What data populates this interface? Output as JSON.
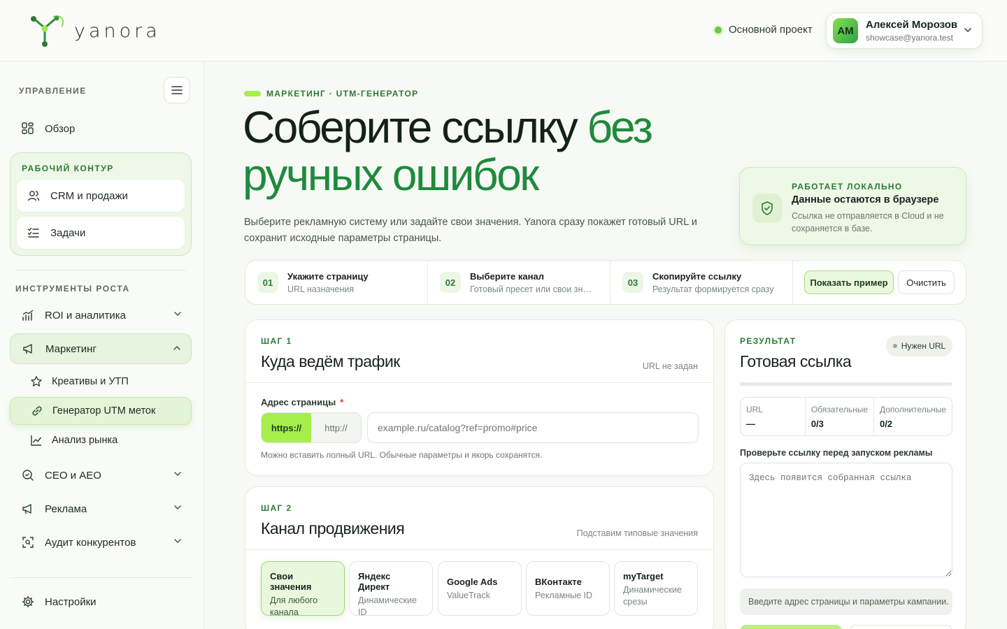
{
  "brand": {
    "name": "yanora"
  },
  "header": {
    "project": "Основной проект",
    "user": {
      "initials": "АМ",
      "name": "Алексей Морозов",
      "email": "showcase@yanora.test"
    }
  },
  "sidebar": {
    "section_manage": "УПРАВЛЕНИЕ",
    "overview": "Обзор",
    "workzone": {
      "title": "РАБОЧИЙ КОНТУР",
      "items": [
        "CRM и продажи",
        "Задачи"
      ]
    },
    "section_growth": "ИНСТРУМЕНТЫ РОСТА",
    "roi": "ROI и аналитика",
    "marketing": "Маркетинг",
    "marketing_sub": [
      "Креативы и УТП",
      "Генератор UTM меток",
      "Анализ рынка"
    ],
    "seo": "СЕО и АЕО",
    "ads": "Реклама",
    "audit": "Аудит конкурентов",
    "settings": "Настройки"
  },
  "main": {
    "eyebrow": "МАРКЕТИНГ · UTM-ГЕНЕРАТОР",
    "hero_dark": "Соберите ссылку ",
    "hero_green": "без ручных ошибок",
    "lead": "Выберите рекламную систему или задайте свои значения. Yanora сразу покажет готовый URL и сохранит исходные параметры страницы.",
    "local": {
      "label": "РАБОТАЕТ ЛОКАЛЬНО",
      "title": "Данные остаются в браузере",
      "desc": "Ссылка не отправляется в Cloud и не сохраняется в базе."
    },
    "steps": [
      {
        "num": "01",
        "title": "Укажите страницу",
        "desc": "URL назначения"
      },
      {
        "num": "02",
        "title": "Выберите канал",
        "desc": "Готовый пресет или свои значения"
      },
      {
        "num": "03",
        "title": "Скопируйте ссылку",
        "desc": "Результат формируется сразу"
      }
    ],
    "btn_example": "Показать пример",
    "btn_clear": "Очистить",
    "step1": {
      "label": "ШАГ 1",
      "title": "Куда ведём трафик",
      "note": "URL не задан",
      "field_label": "Адрес страницы",
      "required_mark": "*",
      "proto_on": "https://",
      "proto_off": "http://",
      "url_placeholder": "example.ru/catalog?ref=promo#price",
      "hint": "Можно вставить полный URL. Обычные параметры и якорь сохранятся."
    },
    "step2": {
      "label": "ШАГ 2",
      "title": "Канал продвижения",
      "note": "Подставим типовые значения",
      "channels": [
        {
          "name": "Свои значения",
          "desc": "Для любого канала"
        },
        {
          "name": "Яндекс Директ",
          "desc": "Динамические ID"
        },
        {
          "name": "Google Ads",
          "desc": "ValueTrack"
        },
        {
          "name": "ВКонтакте",
          "desc": "Рекламные ID"
        },
        {
          "name": "myTarget",
          "desc": "Динамические срезы"
        }
      ]
    },
    "result": {
      "label": "РЕЗУЛЬТАТ",
      "badge": "Нужен URL",
      "title": "Готовая ссылка",
      "progress": 0,
      "stats": [
        {
          "label": "URL",
          "value": "—"
        },
        {
          "label": "Обязательные",
          "value": "0/3"
        },
        {
          "label": "Дополнительные",
          "value": "0/2"
        }
      ],
      "check_label": "Проверьте ссылку перед запуском рекламы",
      "placeholder": "Здесь появится собранная ссылка",
      "info": "Введите адрес страницы и параметры кампании."
    }
  }
}
